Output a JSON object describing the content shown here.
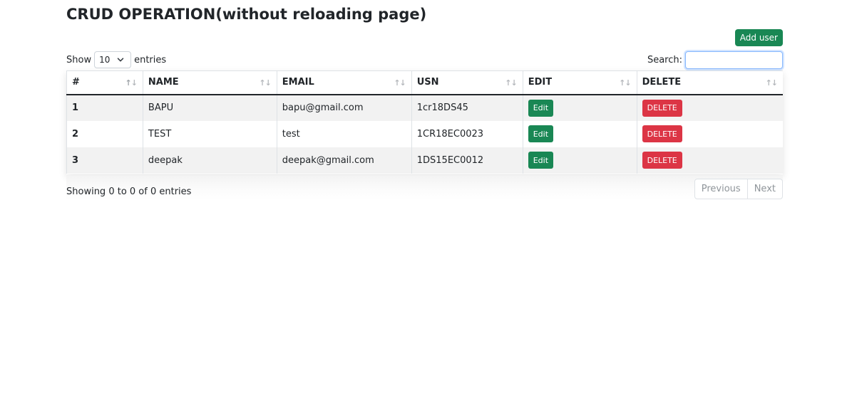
{
  "page": {
    "title": "CRUD OPERATION(without reloading page)",
    "add_user_label": "Add user"
  },
  "length": {
    "show_label": "Show",
    "selected": "10",
    "entries_label": "entries"
  },
  "search": {
    "label": "Search:",
    "value": ""
  },
  "table": {
    "columns": [
      "#",
      "NAME",
      "EMAIL",
      "USN",
      "EDIT",
      "DELETE"
    ],
    "rows": [
      {
        "id": "1",
        "name": "BAPU",
        "email": "bapu@gmail.com",
        "usn": "1cr18DS45",
        "edit": "Edit",
        "delete": "DELETE"
      },
      {
        "id": "2",
        "name": "TEST",
        "email": "test",
        "usn": "1CR18EC0023",
        "edit": "Edit",
        "delete": "DELETE"
      },
      {
        "id": "3",
        "name": "deepak",
        "email": "deepak@gmail.com",
        "usn": "1DS15EC0012",
        "edit": "Edit",
        "delete": "DELETE"
      }
    ]
  },
  "footer": {
    "info": "Showing 0 to 0 of 0 entries",
    "previous": "Previous",
    "next": "Next"
  },
  "colors": {
    "success": "#198754",
    "danger": "#dc3545"
  }
}
